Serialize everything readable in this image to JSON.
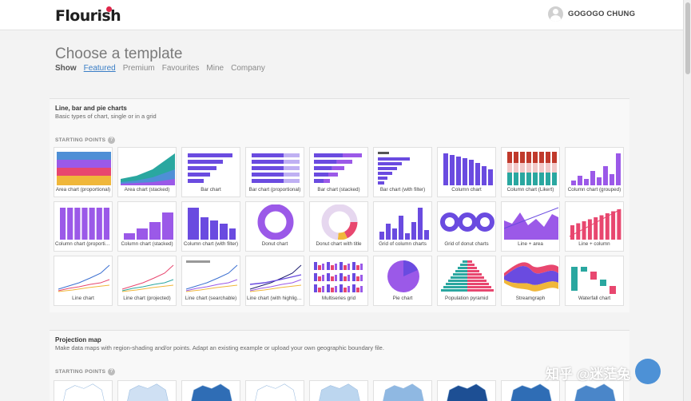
{
  "header": {
    "logo": "Flourish",
    "user": "GOGOGO CHUNG"
  },
  "page": {
    "title": "Choose a template",
    "tabs": [
      {
        "label": "Show"
      },
      {
        "label": "Featured"
      },
      {
        "label": "Premium"
      },
      {
        "label": "Favourites"
      },
      {
        "label": "Mine"
      },
      {
        "label": "Company"
      }
    ]
  },
  "sections": [
    {
      "title": "Line, bar and pie charts",
      "subtitle": "Basic types of chart, single or in a grid",
      "starting_label": "STARTING POINTS",
      "templates": [
        "Area chart (proportional)",
        "Area chart (stacked)",
        "Bar chart",
        "Bar chart (proportional)",
        "Bar chart (stacked)",
        "Bar chart (with filter)",
        "Column chart",
        "Column chart (Likert)",
        "Column chart (grouped)",
        "Column chart (proportional)",
        "Column chart (stacked)",
        "Column chart (with filter)",
        "Donut chart",
        "Donut chart with title",
        "Grid of column charts",
        "Grid of donut charts",
        "Line + area",
        "Line + column",
        "Line chart",
        "Line chart (projected)",
        "Line chart (searchable)",
        "Line chart (with highlights)",
        "Multiseries grid",
        "Pie chart",
        "Population pyramid",
        "Streamgraph",
        "Waterfall chart"
      ]
    },
    {
      "title": "Projection map",
      "subtitle": "Make data maps with region-shading and/or points. Adapt an existing example or upload your own geographic boundary file.",
      "starting_label": "STARTING POINTS"
    }
  ],
  "watermark": "知乎 @迷茫兔",
  "colors": {
    "purple": "#6a4be0",
    "violet": "#9b59e8",
    "pink": "#e8476f",
    "teal": "#2aa7a0",
    "link": "#3a7ec6"
  }
}
